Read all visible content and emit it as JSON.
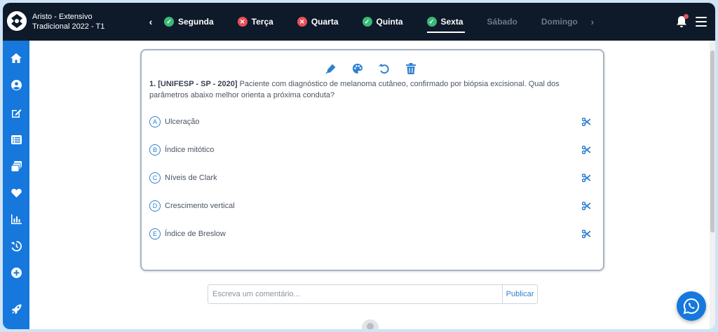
{
  "header": {
    "course_line1": "Aristo - Extensivo",
    "course_line2": "Tradicional 2022 - T1",
    "days": [
      {
        "label": "Segunda",
        "status": "done"
      },
      {
        "label": "Terça",
        "status": "missed"
      },
      {
        "label": "Quarta",
        "status": "missed"
      },
      {
        "label": "Quinta",
        "status": "done"
      },
      {
        "label": "Sexta",
        "status": "done",
        "active": true
      },
      {
        "label": "Sábado",
        "status": "none"
      },
      {
        "label": "Domingo",
        "status": "none"
      }
    ],
    "prev_icon": "chevron-left-icon",
    "next_icon": "chevron-right-icon",
    "notification_icon": "bell-icon",
    "menu_icon": "hamburger-menu-icon"
  },
  "sidebar": {
    "items": [
      {
        "icon": "home-icon"
      },
      {
        "icon": "user-circle-icon"
      },
      {
        "icon": "edit-icon"
      },
      {
        "icon": "list-icon"
      },
      {
        "icon": "cards-icon"
      },
      {
        "icon": "heart-icon"
      },
      {
        "icon": "bar-chart-icon"
      },
      {
        "icon": "history-icon"
      },
      {
        "icon": "plus-circle-icon"
      },
      {
        "icon": "rocket-icon"
      }
    ]
  },
  "question": {
    "tools": [
      "highlighter-icon",
      "palette-icon",
      "undo-icon",
      "trash-icon"
    ],
    "source": "1. [UNIFESP - SP - 2020]",
    "text": "Paciente com diagnóstico de melanoma cutâneo, confirmado por biópsia excisional. Qual dos parâmetros abaixo melhor orienta a próxima conduta?",
    "alternatives": [
      {
        "letter": "A",
        "text": "Ulceração"
      },
      {
        "letter": "B",
        "text": "Índice mitótico"
      },
      {
        "letter": "C",
        "text": "Níveis de Clark"
      },
      {
        "letter": "D",
        "text": "Crescimento vertical"
      },
      {
        "letter": "E",
        "text": "Índice de Breslow"
      }
    ]
  },
  "comment": {
    "placeholder": "Escreva um comentário...",
    "publish_label": "Publicar"
  },
  "colors": {
    "topbar": "#0e1a2a",
    "sidebar": "#1678dc",
    "accent": "#2f80d1",
    "done": "#3cb878",
    "missed": "#e9505a"
  }
}
